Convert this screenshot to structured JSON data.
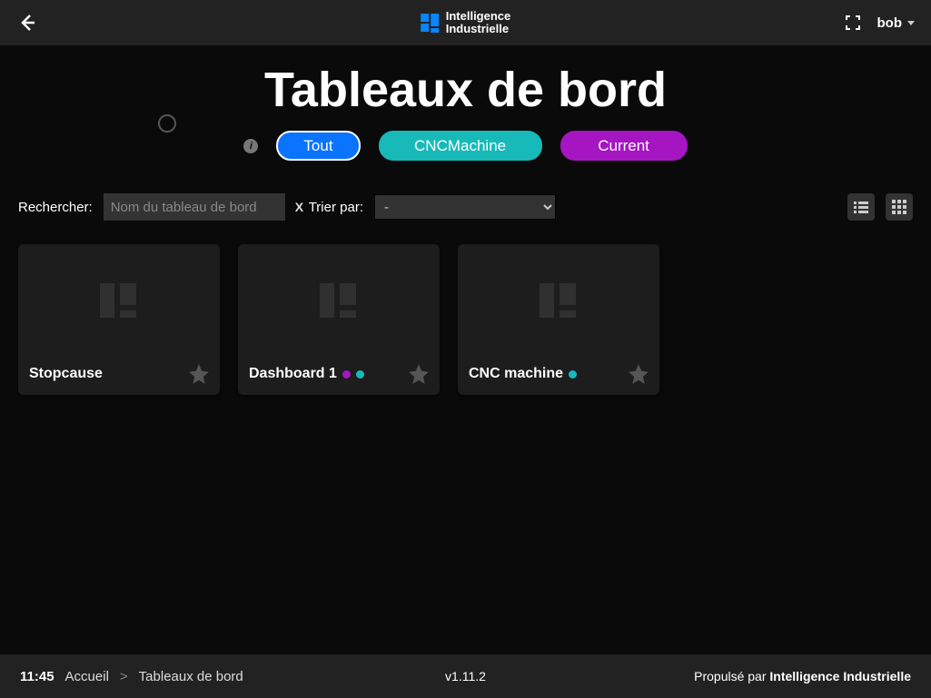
{
  "header": {
    "brand_line1": "Intelligence",
    "brand_line2": "Industrielle",
    "user_name": "bob"
  },
  "page": {
    "title": "Tableaux de bord"
  },
  "filters": {
    "all": "Tout",
    "cnc": "CNCMachine",
    "current": "Current"
  },
  "controls": {
    "search_label": "Rechercher:",
    "search_placeholder": "Nom du tableau de bord",
    "search_clear": "X",
    "sort_label": "Trier par:",
    "sort_value": "-"
  },
  "dashboards": [
    {
      "name": "Stopcause",
      "tags": []
    },
    {
      "name": "Dashboard 1",
      "tags": [
        "purple",
        "teal"
      ]
    },
    {
      "name": "CNC machine",
      "tags": [
        "teal"
      ]
    }
  ],
  "footer": {
    "time": "11:45",
    "home": "Accueil",
    "current": "Tableaux de bord",
    "version": "v1.11.2",
    "powered_prefix": "Propulsé par ",
    "powered_brand": "Intelligence Industrielle"
  }
}
